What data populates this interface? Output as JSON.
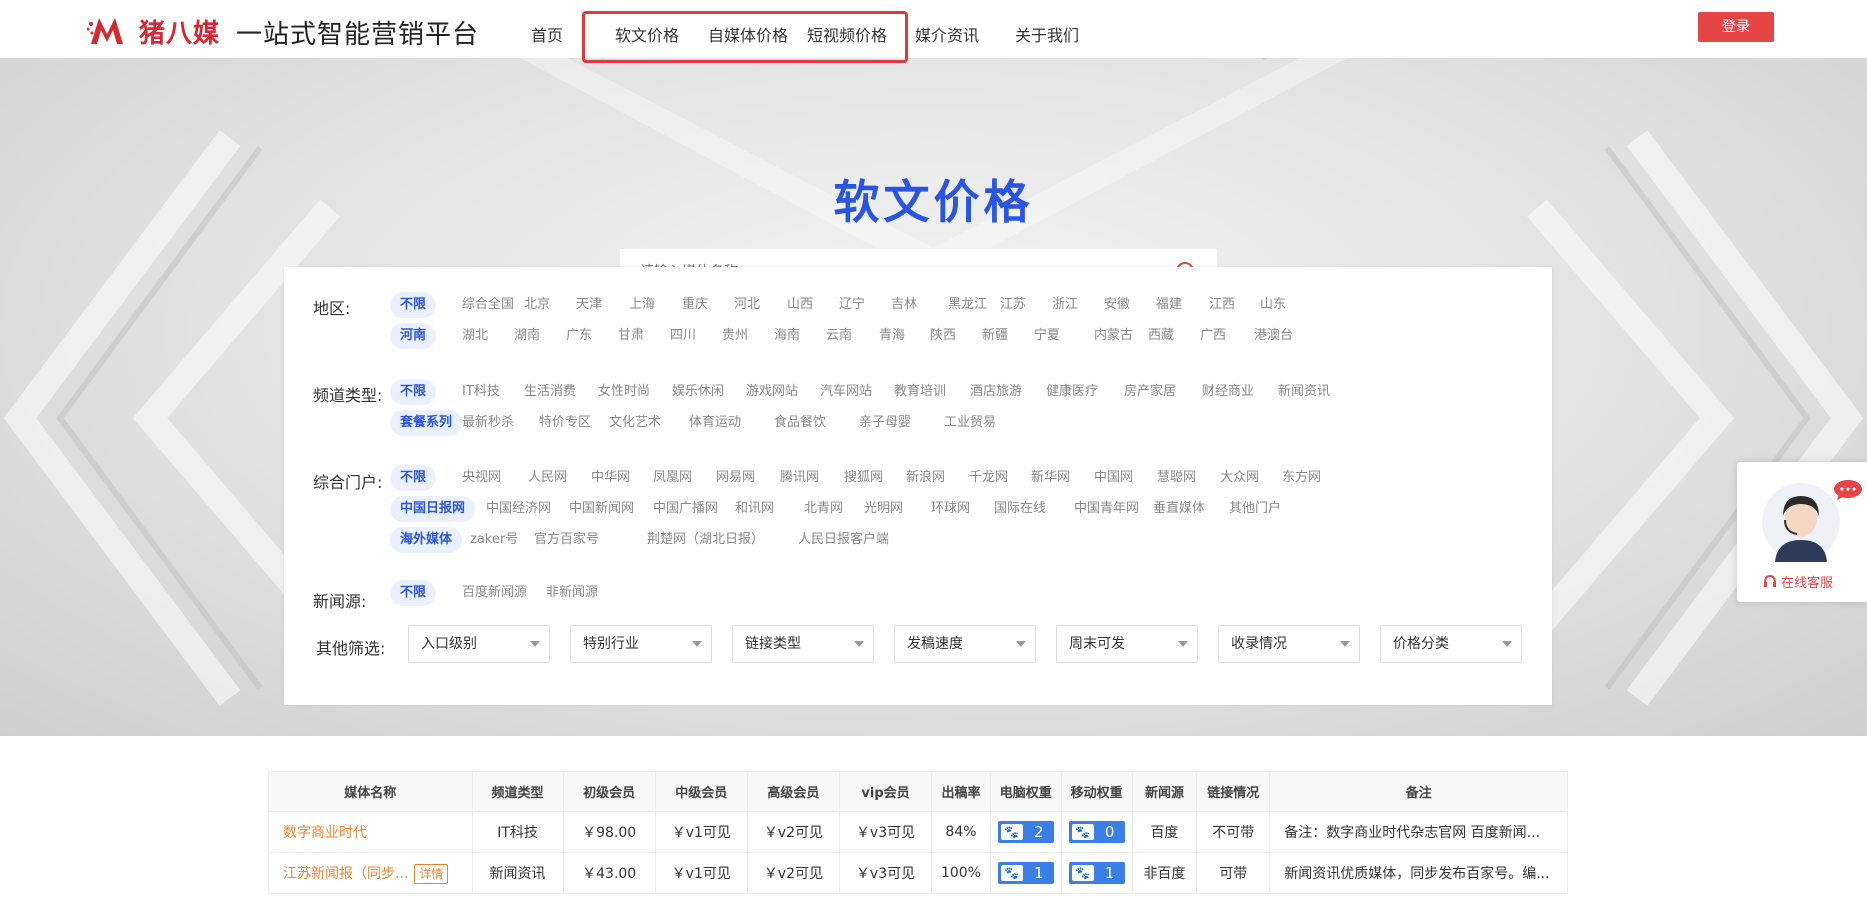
{
  "header": {
    "brand": "猪八媒",
    "slogan": "一站式智能营销平台",
    "nav": [
      "首页",
      "软文价格",
      "自媒体价格",
      "短视频价格",
      "媒介资讯",
      "关于我们"
    ],
    "login": "登录"
  },
  "hero": {
    "title": "软文价格",
    "search_placeholder": "请输入媒体名称"
  },
  "filters": {
    "region": {
      "label": "地区:",
      "row1": [
        "不限",
        "综合全国",
        "北京",
        "天津",
        "上海",
        "重庆",
        "河北",
        "山西",
        "辽宁",
        "吉林",
        "黑龙江",
        "江苏",
        "浙江",
        "安徽",
        "福建",
        "江西",
        "山东"
      ],
      "row2": [
        "河南",
        "湖北",
        "湖南",
        "广东",
        "甘肃",
        "四川",
        "贵州",
        "海南",
        "云南",
        "青海",
        "陕西",
        "新疆",
        "宁夏",
        "内蒙古",
        "西藏",
        "广西",
        "港澳台"
      ]
    },
    "channel": {
      "label": "频道类型:",
      "row1": [
        "不限",
        "IT科技",
        "生活消费",
        "女性时尚",
        "娱乐休闲",
        "游戏网站",
        "汽车网站",
        "教育培训",
        "酒店旅游",
        "健康医疗",
        "房产家居",
        "财经商业",
        "新闻资讯"
      ],
      "row2": [
        "套餐系列",
        "最新秒杀",
        "特价专区",
        "文化艺术",
        "体育运动",
        "食品餐饮",
        "亲子母婴",
        "工业贸易"
      ]
    },
    "portal": {
      "label": "综合门户:",
      "row1": [
        "不限",
        "央视网",
        "人民网",
        "中华网",
        "凤凰网",
        "网易网",
        "腾讯网",
        "搜狐网",
        "新浪网",
        "千龙网",
        "新华网",
        "中国网",
        "慧聪网",
        "大众网",
        "东方网"
      ],
      "row2": [
        "中国日报网",
        "中国经济网",
        "中国新闻网",
        "中国广播网",
        "和讯网",
        "北青网",
        "光明网",
        "环球网",
        "国际在线",
        "中国青年网",
        "垂直媒体",
        "其他门户"
      ],
      "row3": [
        "海外媒体",
        "zaker号",
        "官方百家号",
        "荆楚网（湖北日报）",
        "人民日报客户端"
      ]
    },
    "news": {
      "label": "新闻源:",
      "row1": [
        "不限",
        "百度新闻源",
        "非新闻源"
      ]
    },
    "other": {
      "label": "其他筛选:",
      "selects": [
        "入口级别",
        "特别行业",
        "链接类型",
        "发稿速度",
        "周末可发",
        "收录情况",
        "价格分类"
      ]
    }
  },
  "customer_service": {
    "label": "在线客服",
    "bubble": "···"
  },
  "table": {
    "headers": [
      "媒体名称",
      "频道类型",
      "初级会员",
      "中级会员",
      "高级会员",
      "vip会员",
      "出稿率",
      "电脑权重",
      "移动权重",
      "新闻源",
      "链接情况",
      "备注"
    ],
    "rows": [
      {
        "name": "数字商业时代",
        "tag": "",
        "channel": "IT科技",
        "basic": "￥98.00",
        "mid": "￥v1可见",
        "senior": "￥v2可见",
        "vip": "￥v3可见",
        "rate": "84%",
        "pc": "2",
        "mobile": "0",
        "news": "百度",
        "link": "不可带",
        "note": "备注：数字商业时代杂志官网 百度新闻..."
      },
      {
        "name": "江苏新闻报（同步...",
        "tag": "详情",
        "channel": "新闻资讯",
        "basic": "￥43.00",
        "mid": "￥v1可见",
        "senior": "￥v2可见",
        "vip": "￥v3可见",
        "rate": "100%",
        "pc": "1",
        "mobile": "1",
        "news": "非百度",
        "link": "可带",
        "note": "新闻资讯优质媒体，同步发布百家号。编..."
      }
    ]
  },
  "colors": {
    "accent_blue": "#2a55e3",
    "brand_red": "#d7282f",
    "price_orange": "#f0832a",
    "weight_blue": "#3a7fe5"
  }
}
